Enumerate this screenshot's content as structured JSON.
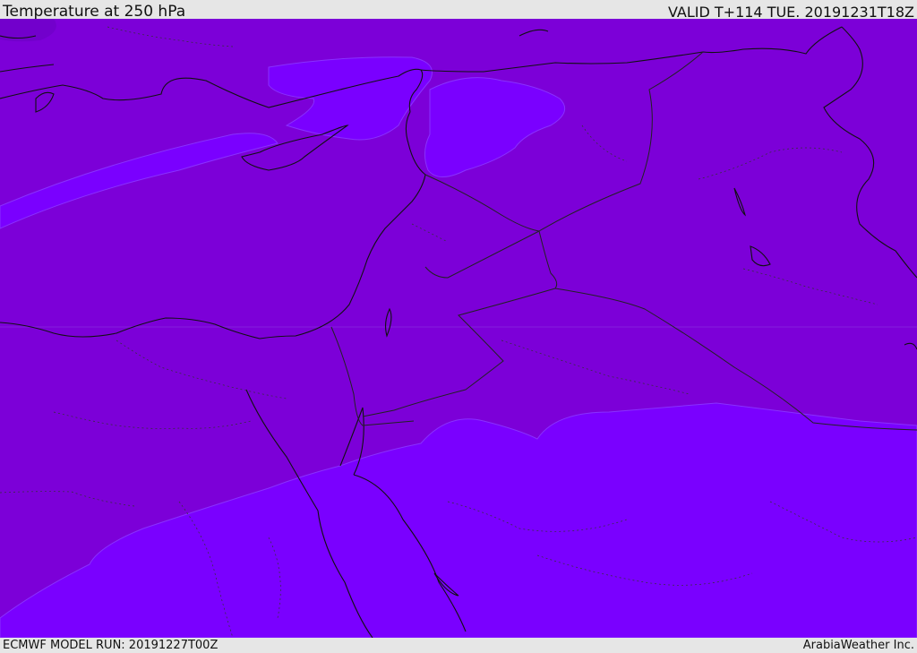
{
  "header": {
    "title": "Temperature at 250 hPa",
    "valid": "VALID T+114 TUE. 20191231T18Z"
  },
  "footer": {
    "model_run": "ECMWF MODEL RUN: 20191227T00Z",
    "credit": "ArabiaWeather Inc."
  },
  "colors": {
    "base_fill": "#7c00d8",
    "warm_fill": "#7a00ff",
    "pocket_fill": "#7200cc",
    "coastline": "#111111",
    "border": "#222222"
  }
}
